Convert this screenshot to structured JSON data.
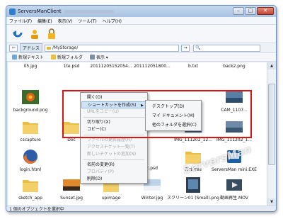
{
  "window": {
    "title": "ServersManClient",
    "buttons": [
      "–",
      "□",
      "✕"
    ]
  },
  "menubar": {
    "items": [
      "ファイル(F)",
      "編集(E)",
      "表示(V)",
      "ツール(T)",
      "ヘルプ(H)"
    ]
  },
  "toolbar": {
    "icons": [
      "back-arrow-icon",
      "user-icon",
      "lock-icon"
    ]
  },
  "address": {
    "label": "アドレス",
    "path": "/MyStorage/",
    "go_label": "→",
    "search_placeholder": "🔍"
  },
  "commands": [
    {
      "label": "新規テキスト",
      "icon": "new-text-icon"
    },
    {
      "label": "新規フォルダ",
      "icon": "new-folder-icon"
    },
    {
      "label": "表示 ▾",
      "icon": "view-icon"
    }
  ],
  "files_top_row": [
    "05.jpg",
    "1te.psd",
    "20111205152054...",
    "201112051800...",
    "b.txt",
    "back2.png"
  ],
  "files": [
    {
      "name": "background.png",
      "type": "flower"
    },
    {
      "name": "CAM_1107...",
      "type": "photo"
    },
    {
      "name": "cscapture",
      "type": "folder"
    },
    {
      "name": "Doc",
      "type": "folder"
    },
    {
      "name": "IMG_111202_12...",
      "type": "photo"
    },
    {
      "name": "IMG_111202_1...",
      "type": "photo"
    },
    {
      "name": "login.html",
      "type": "browser"
    },
    {
      "name": "Pictures",
      "type": "folder"
    },
    {
      "name": "ServersMan mini.EXE",
      "type": "app"
    },
    {
      "name": "sketch_app",
      "type": "folder"
    },
    {
      "name": "Sunset.jpg",
      "type": "photo"
    },
    {
      "name": "upimage",
      "type": "folder"
    },
    {
      "name": "Winter.jpg",
      "type": "photo"
    },
    {
      "name": "スクリーン01 (Small).png",
      "type": "photo"
    },
    {
      "name": "動画再生.MOV",
      "type": "video"
    },
    {
      "name": "c.psd",
      "type": "psd"
    }
  ],
  "context_menu": {
    "items": [
      {
        "label": "開く(O)",
        "disabled": false
      },
      {
        "label": "ショートカットを作成(S)",
        "disabled": false,
        "submenu": true
      },
      {
        "label": "URLをコピー(U)",
        "disabled": true
      },
      {
        "label": "切り取り(X)",
        "disabled": false
      },
      {
        "label": "コピー(C)",
        "disabled": false
      },
      {
        "label": "ファイルの更新履歴(H)",
        "disabled": true
      },
      {
        "label": "アクセスチケット一覧(T)",
        "disabled": true
      },
      {
        "label": "新しいチケットの追加(N)",
        "disabled": true
      },
      {
        "label": "名前の変更(R)",
        "disabled": false
      },
      {
        "label": "プロパティ(P)",
        "disabled": true
      },
      {
        "label": "削除(D)",
        "disabled": false
      }
    ]
  },
  "submenu": {
    "items": [
      "デスクトップ(D)",
      "マイ ドキュメント(M)",
      "他のフォルダを選択(C)"
    ]
  },
  "status": {
    "text": "1 個のオブジェクトを選択中"
  },
  "watermark": {
    "text": "ServersMan"
  },
  "colors": {
    "highlight": "#e01111",
    "menu_hover": "#cfe3f8"
  }
}
